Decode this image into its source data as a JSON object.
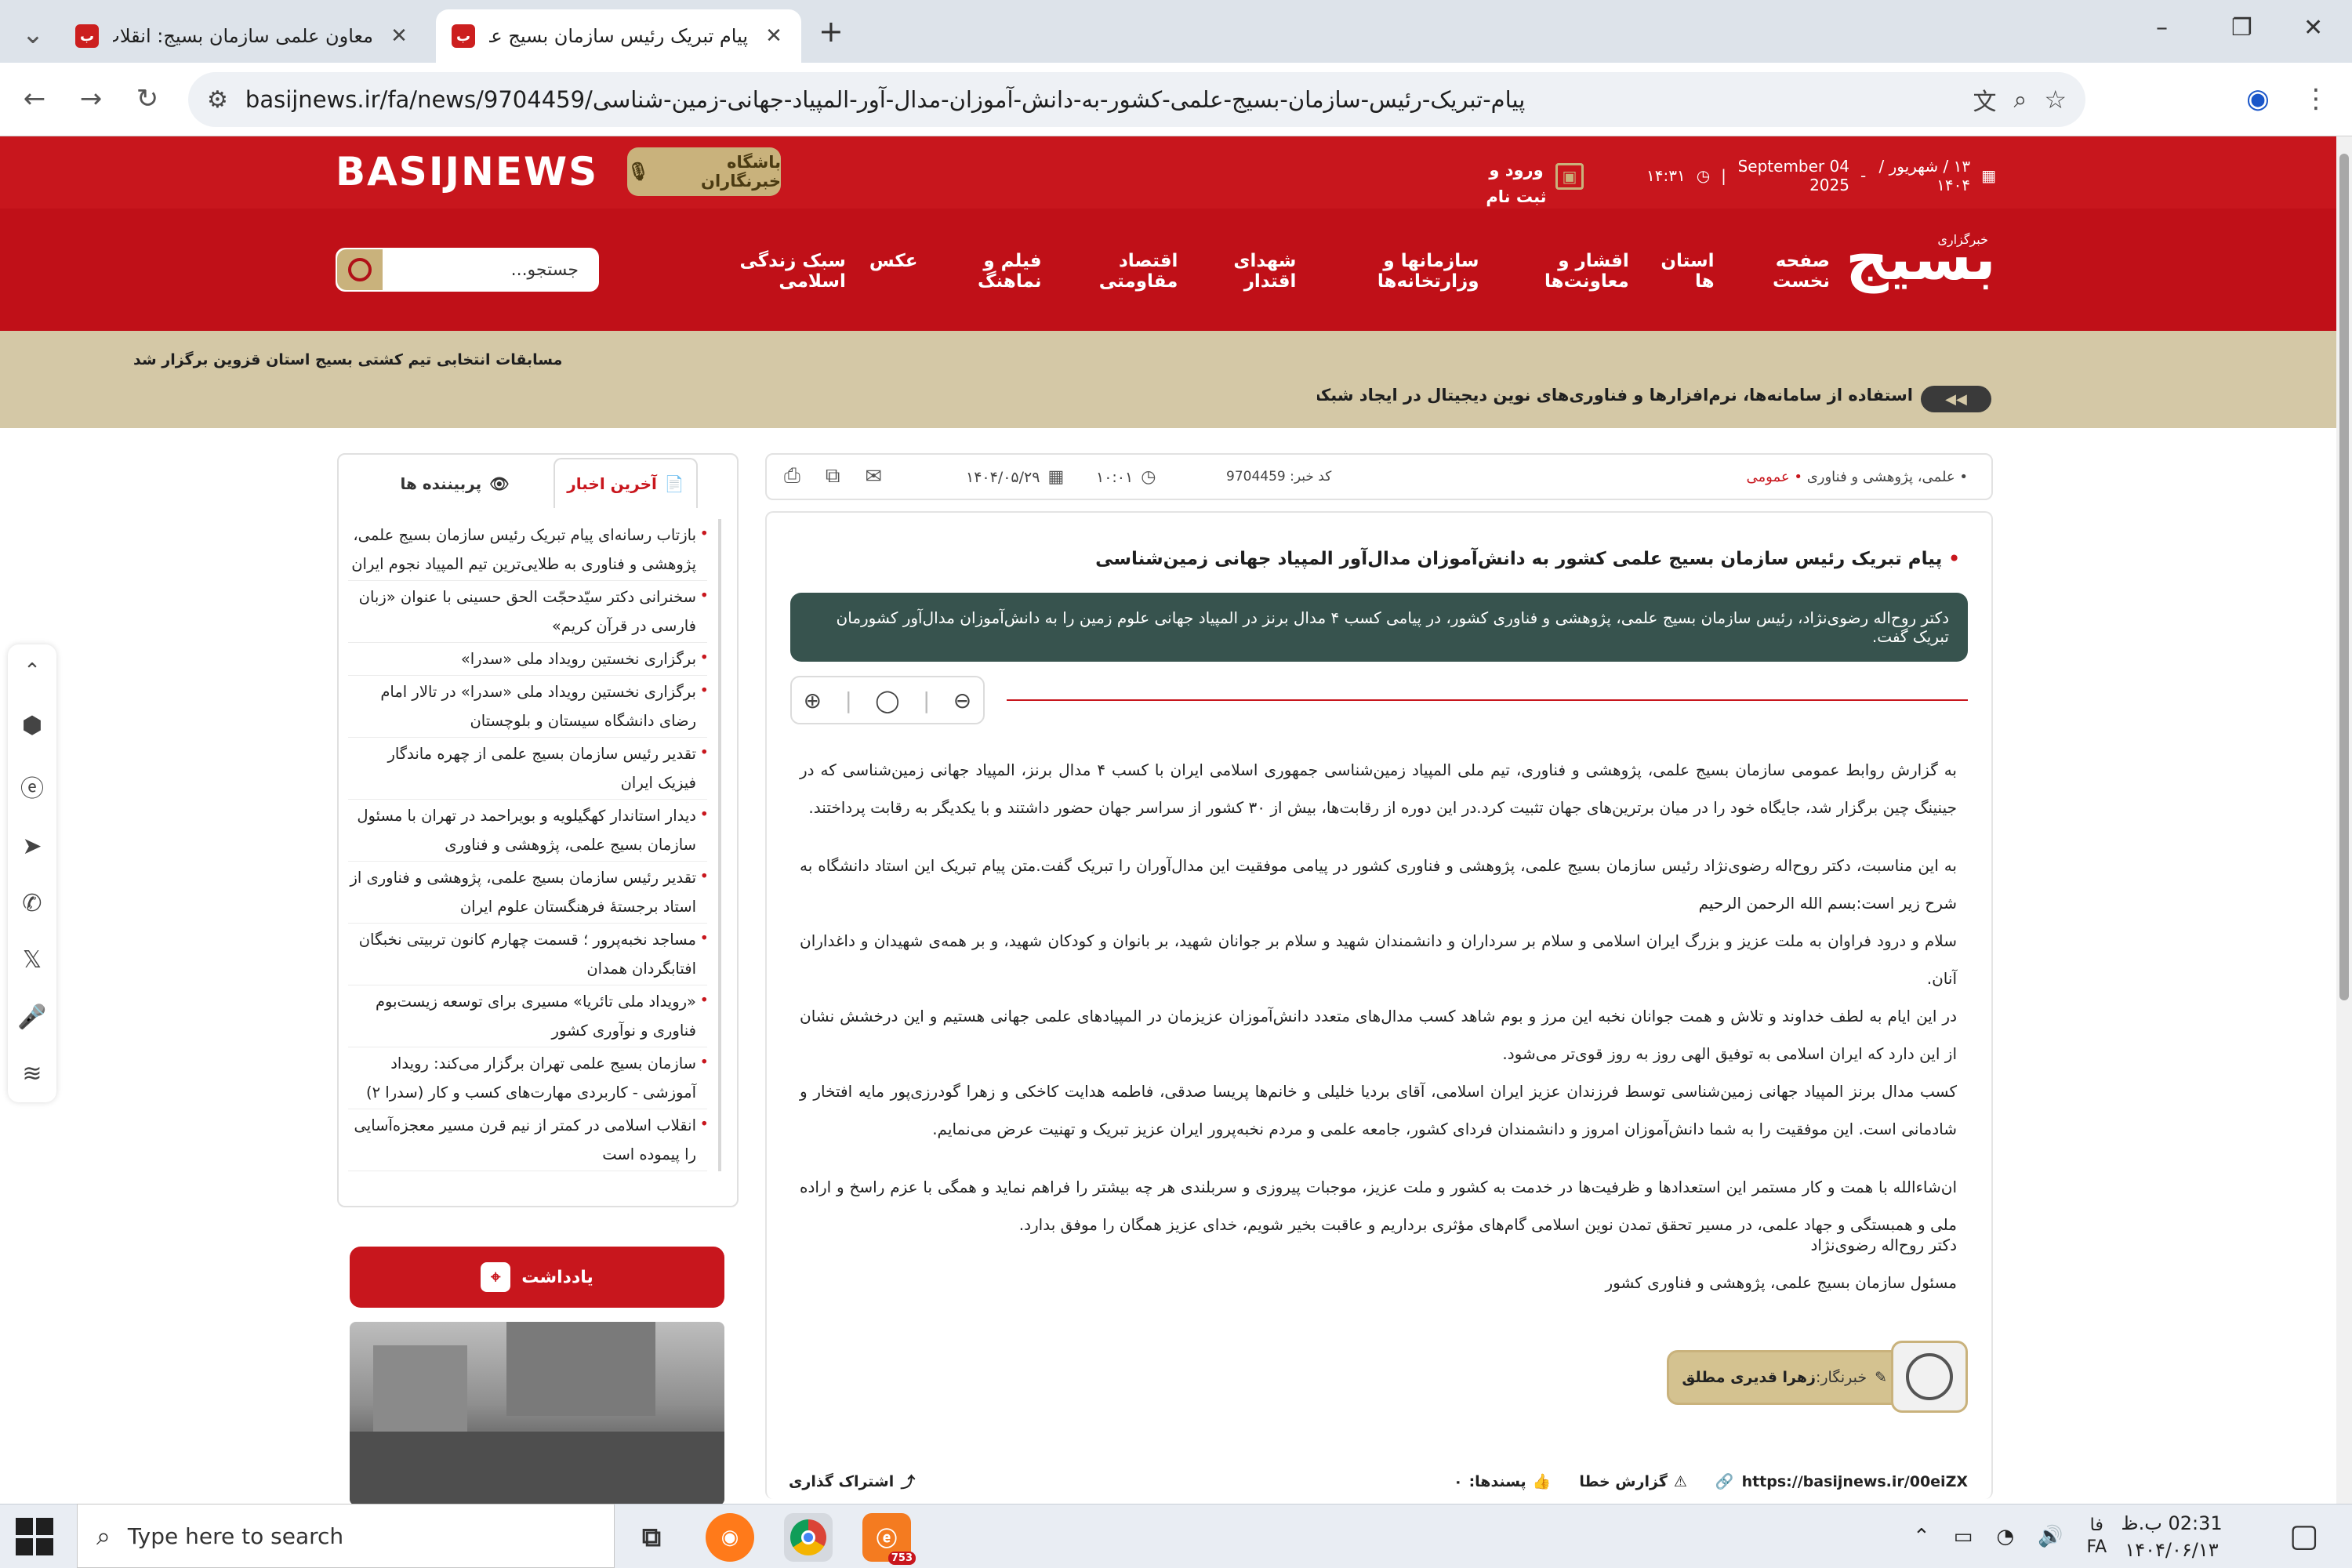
{
  "browser": {
    "tabs": [
      {
        "title": "معاون علمی سازمان بسیج: انقلاب",
        "favicon": "ب"
      },
      {
        "title": "پیام تبریک رئیس سازمان بسیج علمی",
        "favicon": "ب"
      }
    ],
    "new_tab": "+",
    "url": "basijnews.ir/fa/news/9704459/پیام-تبریک-رئیس-سازمان-بسیج-علمی-کشور-به-دانش-آموزان-مدال-آور-المپیاد-جهانی-زمین-شناسی",
    "window_controls": {
      "minimize": "–",
      "restore": "❐",
      "close": "✕"
    }
  },
  "header": {
    "logo_en": "BASIJNEWS",
    "reporters_club": "باشگاه خبرنگاران",
    "date_fa": "۱۳ / شهریور / ۱۴۰۴",
    "date_en": "04 September 2025",
    "time": "۱۴:۳۱",
    "login": "ورود و ثبت نام",
    "logo_fa": "بسیج",
    "logo_fa_sub": "خبرگزاری",
    "nav": [
      "صفحه نخست",
      "استان ها",
      "اقشار و معاونت‌ها",
      "سازمانها و وزارتخانه‌ها",
      "شهدای اقتدار",
      "اقتصاد مقاومتی",
      "فیلم و نماهنگ",
      "عکس",
      "سبک زندگی اسلامی"
    ],
    "search_placeholder": "جستجو..."
  },
  "ticker": {
    "top": "مسابقات انتخابی تیم کشتی بسیج استان قزوین برگزار شد",
    "main": "استفاده از سامانه‌ها، نرم‌افزارها و فناوری‌های نوین دیجیتال در ایجاد شبکه‌های مردمی در فق"
  },
  "article": {
    "category_prefix": "علمی، پژوهشی و فناوری",
    "category": "عمومی",
    "code_label": "کد خبر: 9704459",
    "time": "۱۰:۰۱",
    "date": "۱۴۰۴/۰۵/۲۹",
    "title": "پیام تبریک رئیس سازمان بسیج علمی کشور به دانش‌آموزان مدال‌آور المپیاد جهانی زمین‌شناسی",
    "lead": "دکتر روح‌اله رضوی‌نژاد، رئیس سازمان بسیج علمی، پژوهشی و فناوری کشور، در پیامی کسب ۴ مدال برنز در المپیاد جهانی علوم زمین را به دانش‌آموزان مدال‌آور کشورمان تبریک گفت.",
    "paragraphs": [
      "به گزارش روابط عمومی سازمان بسیج علمی، پژوهشی و فناوری، تیم ملی المپیاد زمین‌شناسی جمهوری اسلامی ایران با کسب ۴ مدال برنز، المپیاد جهانی زمین‌شناسی که در جینینگ چین برگزار شد، جایگاه خود را در میان برترین‌های جهان تثبیت کرد.در این دوره از رقابت‌ها، بیش از ۳۰ کشور از سراسر جهان حضور داشتند و با یکدیگر به رقابت پرداختند.",
      "به این مناسبت، دکتر روح‌اله رضوی‌نژاد رئیس سازمان بسیج علمی، پژوهشی و فناوری کشور در پیامی موفقیت این مدال‌آوران را تبریک گفت.متن پیام تبریک این استاد دانشگاه به شرح زیر است:بسم الله الرحمن الرحیم",
      "سلام و درود فراوان به ملت عزیز و بزرگ ایران اسلامی و سلام بر سرداران و دانشمندان شهید و سلام بر جوانان شهید، بر بانوان و کودکان شهید، و بر همه‌ی شهیدان و داغداران آنان.",
      "در این ایام به لطف خداوند و تلاش و همت جوانان نخبه این مرز و بوم شاهد کسب مدال‌های متعدد دانش‌آموزان عزیزمان در المپیادهای علمی جهانی هستیم و این درخشش نشان از این دارد که ایران اسلامی به توفیق الهی روز به روز قوی‌تر می‌شود.",
      "کسب مدال برنز المپیاد جهانی زمین‌شناسی توسط فرزندان عزیز ایران اسلامی، آقای بردیا خلیلی و خانم‌ها پریسا صدقی، فاطمه هدایت کاخکی و زهرا گودرزی‌پور مایه افتخار و شادمانی است. این موفقیت را به شما دانش‌آموزان امروز و دانشمندان فردای کشور، جامعه علمی و مردم نخبه‌پرور ایران عزیز تبریک و تهنیت عرض می‌نمایم.",
      "ان‌شاءالله با همت و کار مستمر این استعدادها و ظرفیت‌ها در خدمت به کشور و ملت عزیز، موجبات پیروزی و سربلندی هر چه بیشتر را فراهم نماید و همگی با عزم راسخ و اراده ملی و همبستگی و جهاد علمی، در مسیر تحقق تمدن نوین اسلامی گام‌های مؤثری برداریم و عاقبت بخیر شویم، خدای عزیز همگان را موفق بدارد."
    ],
    "signature_name": "دکتر روح‌اله رضوی‌نژاد",
    "signature_title": "مسئول سازمان بسیج علمی، پژوهشی و فناوری کشور",
    "reporter_label": "خبرنگار:",
    "reporter_name": "زهرا قدیری مطلق",
    "short_url": "https://basijnews.ir/00eiZX",
    "report_error": "گزارش خطا",
    "likes_label": "پسندها:",
    "likes": "۰",
    "share": "اشتراک گذاری"
  },
  "sidebar": {
    "tab_latest": "آخرین اخبار",
    "tab_popular": "پربیننده ها",
    "news": [
      "بازتاب رسانه‌ای پیام تبریک رئیس سازمان بسیج علمی، پژوهشی و فناوری به طلایی‌ترین تیم المپیاد نجوم ایران",
      "سخنرانی دکتر سیّدحجّت الحق حسینی با عنوان «زبان فارسی در قرآن کریم»",
      "برگزاری نخستین رویداد ملی «سدرا»",
      "برگزاری نخستین رویداد ملی «سدرا» در تالار امام رضای دانشگاه سیستان و بلوچستان",
      "تقدیر رئیس سازمان بسیج علمی از چهره ماندگار فیزیک ایران",
      "دیدار استاندار کهگیلویه و بویراحمد در تهران با مسئول سازمان بسیج علمی، پژوهشی و فناوری",
      "تقدیر رئیس سازمان بسیج علمی، پژوهشی و فناوری از استاد برجستهٔ فرهنگستان علوم ایران",
      "مساجد نخبه‌پرور ؛ قسمت چهارم کانون تربیتی نخبگان افتابگردان همدان",
      "«رویداد ملی تائریا» مسیری برای توسعه زیست‌بوم فناوری و نوآوری کشور",
      "سازمان بسیج علمی تهران برگزار می‌کند: رویداد آموزشی - کاربردی مهارت‌های کسب و کار (سدرا ۲)",
      "انقلاب اسلامی در کمتر از نیم قرن مسیر معجزه‌آسایی را پیموده است"
    ],
    "note_btn": "یادداشت"
  },
  "taskbar": {
    "search_placeholder": "Type here to search",
    "lang": "فا",
    "lang_sub": "FA",
    "time": "02:31 ب.ظ",
    "date": "۱۴۰۴/۰۶/۱۳",
    "badge": "753"
  }
}
